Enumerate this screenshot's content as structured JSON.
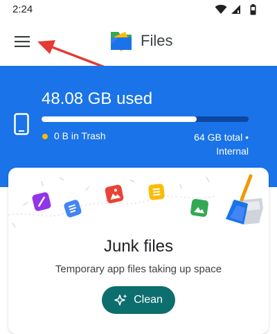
{
  "status_bar": {
    "time": "2:24",
    "icons": [
      "wifi-icon",
      "signal-icon",
      "battery-icon"
    ]
  },
  "app_bar": {
    "title": "Files",
    "menu_icon": "hamburger-menu-icon"
  },
  "storage": {
    "used": "48.08 GB used",
    "used_fraction": 0.75,
    "trash": "0 B in Trash",
    "total_line1": "64 GB total •",
    "total_line2": "Internal",
    "icon": "phone-icon"
  },
  "junk_card": {
    "title": "Junk files",
    "subtitle": "Temporary app files taking up space",
    "button_label": "Clean",
    "button_icon": "sparkle-icon"
  },
  "colors": {
    "header_blue": "#1a73e8",
    "button_teal": "#0d6e6e",
    "trash_dot": "#fbbc04",
    "arrow_red": "#e53935"
  }
}
